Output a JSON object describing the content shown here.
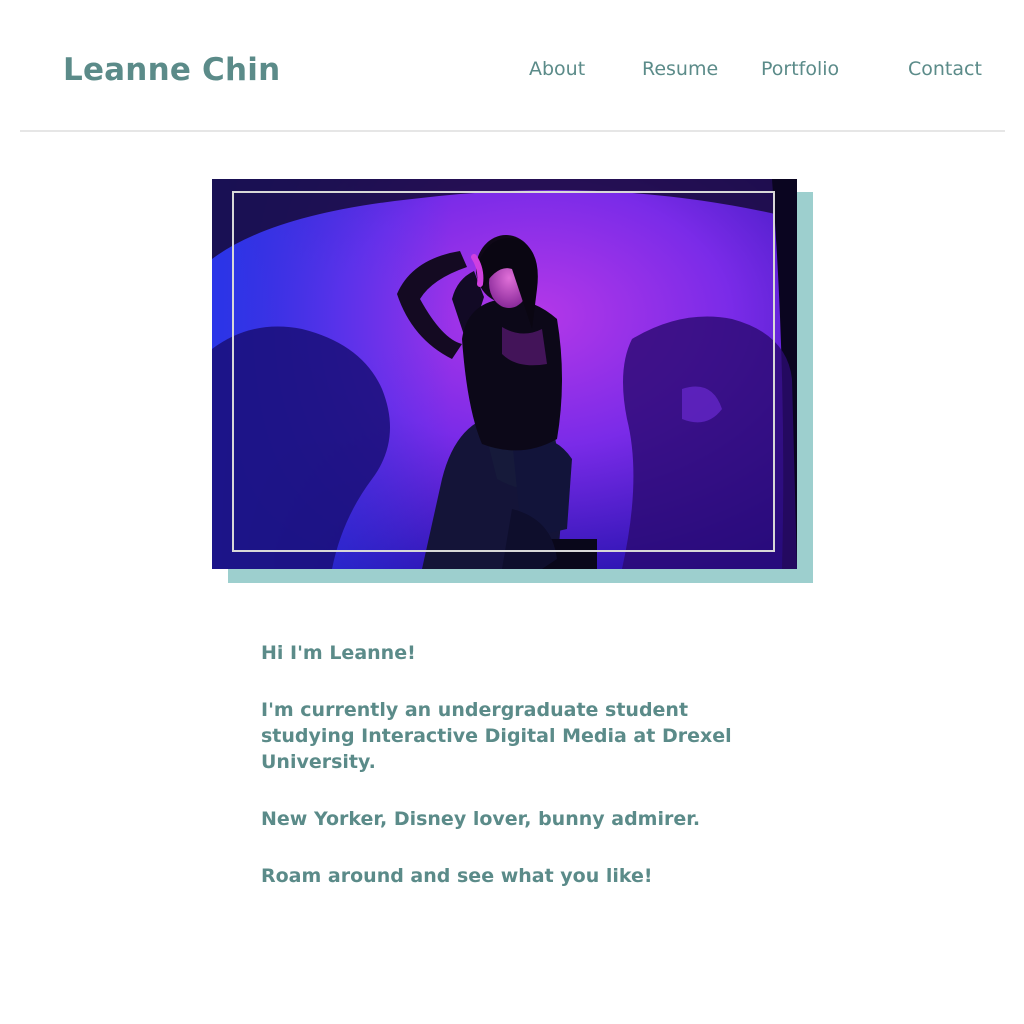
{
  "header": {
    "site_title": "Leanne Chin",
    "nav": {
      "about": "About",
      "resume": "Resume",
      "portfolio": "Portfolio",
      "contact": "Contact"
    }
  },
  "hero": {
    "image_alt": "Portrait of Leanne sitting under blue and purple lights"
  },
  "intro": {
    "greeting": "Hi I'm Leanne!",
    "line1": "I'm currently an undergraduate student studying Interactive Digital Media at Drexel University.",
    "line2": "New Yorker, Disney lover, bunny admirer.",
    "line3": "Roam around and see what you like!"
  },
  "colors": {
    "text_teal": "#5b8b89",
    "shadow_teal": "#9dcfce",
    "divider_gray": "#e6e6e6"
  }
}
